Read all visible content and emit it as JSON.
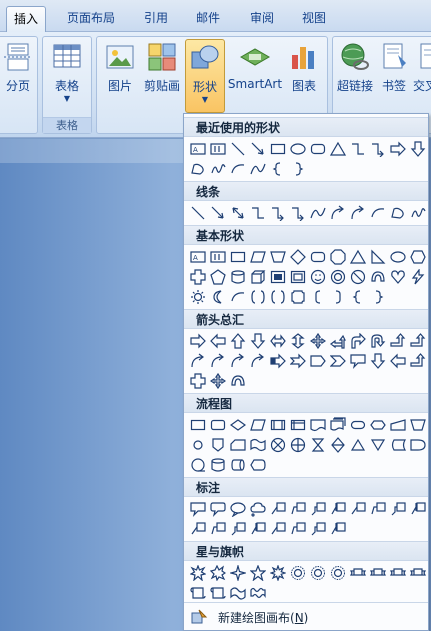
{
  "tabs": [
    {
      "label": "插入",
      "active": true
    },
    {
      "label": "页面布局",
      "active": false
    },
    {
      "label": "引用",
      "active": false
    },
    {
      "label": "邮件",
      "active": false
    },
    {
      "label": "审阅",
      "active": false
    },
    {
      "label": "视图",
      "active": false
    }
  ],
  "ribbon": {
    "groups": {
      "pages": {
        "button": "分页"
      },
      "tables": {
        "label": "表格",
        "button": "表格"
      },
      "illustrations": {
        "buttons": {
          "picture": "图片",
          "clipart": "剪贴画",
          "shapes": "形状",
          "smartart": "SmartArt",
          "chart": "图表"
        }
      },
      "links": {
        "buttons": {
          "hyperlink": "超链接",
          "bookmark": "书签",
          "crossref": "交叉引"
        }
      }
    }
  },
  "shapes_menu": {
    "sections": {
      "recent": "最近使用的形状",
      "lines": "线条",
      "basic": "基本形状",
      "arrows": "箭头总汇",
      "flowchart": "流程图",
      "callouts": "标注",
      "stars": "星与旗帜"
    },
    "new_canvas": {
      "label": "新建绘图画布(",
      "key": "N",
      "suffix": ")"
    }
  },
  "colors": {
    "accent": "#15428b",
    "shape_stroke": "#1f3f73",
    "pressed": "#f9c463"
  }
}
